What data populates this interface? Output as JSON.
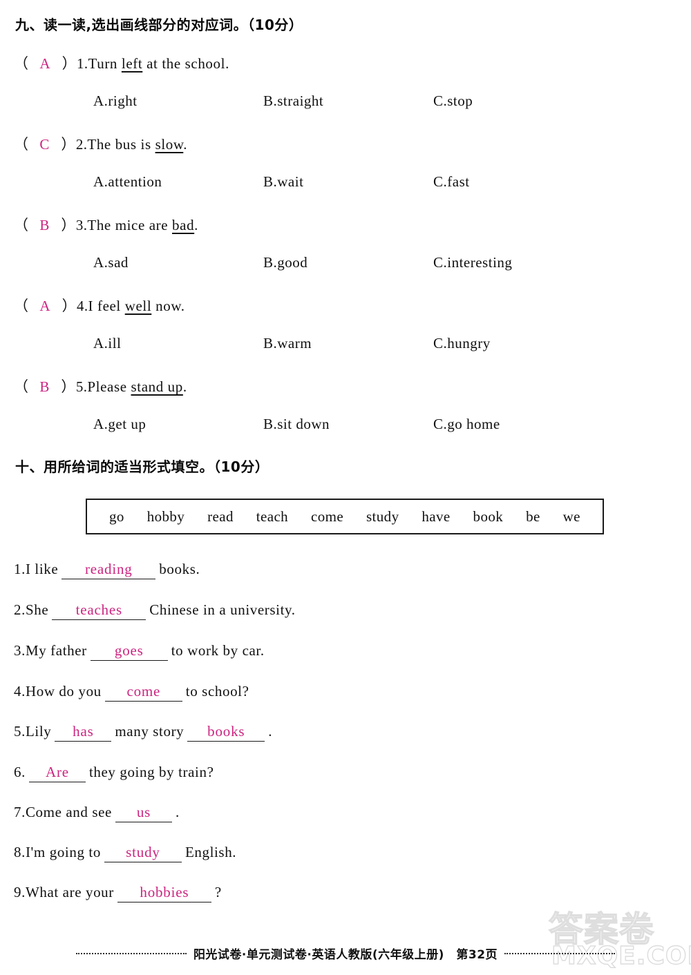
{
  "section9": {
    "heading": "九、读一读,选出画线部分的对应词。（10分）",
    "questions": [
      {
        "answer": "A",
        "number": "1.",
        "stem_before": "Turn ",
        "stem_underlined": "left",
        "stem_after": " at the school.",
        "options": {
          "a": "A.right",
          "b": "B.straight",
          "c": "C.stop"
        }
      },
      {
        "answer": "C",
        "number": "2.",
        "stem_before": "The bus is ",
        "stem_underlined": "slow",
        "stem_after": ".",
        "options": {
          "a": "A.attention",
          "b": "B.wait",
          "c": "C.fast"
        }
      },
      {
        "answer": "B",
        "number": "3.",
        "stem_before": "The mice are ",
        "stem_underlined": "bad",
        "stem_after": ".",
        "options": {
          "a": "A.sad",
          "b": "B.good",
          "c": "C.interesting"
        }
      },
      {
        "answer": "A",
        "number": "4.",
        "stem_before": "I feel ",
        "stem_underlined": "well",
        "stem_after": " now.",
        "options": {
          "a": "A.ill",
          "b": "B.warm",
          "c": "C.hungry"
        }
      },
      {
        "answer": "B",
        "number": "5.",
        "stem_before": "Please ",
        "stem_underlined": "stand up",
        "stem_after": ".",
        "options": {
          "a": "A.get up",
          "b": "B.sit down",
          "c": "C.go home"
        }
      }
    ]
  },
  "section10": {
    "heading": "十、用所给词的适当形式填空。（10分）",
    "word_bank": [
      "go",
      "hobby",
      "read",
      "teach",
      "come",
      "study",
      "have",
      "book",
      "be",
      "we"
    ],
    "items": [
      {
        "number": "1.",
        "before": "I like",
        "blank1": "reading",
        "middle": "books.",
        "blank2": null,
        "after": null
      },
      {
        "number": "2.",
        "before": "She",
        "blank1": "teaches",
        "middle": "Chinese in a university.",
        "blank2": null,
        "after": null
      },
      {
        "number": "3.",
        "before": "My father",
        "blank1": "goes",
        "middle": "to work by car.",
        "blank2": null,
        "after": null
      },
      {
        "number": "4.",
        "before": "How do you",
        "blank1": "come",
        "middle": "to school?",
        "blank2": null,
        "after": null
      },
      {
        "number": "5.",
        "before": "Lily",
        "blank1": "has",
        "middle": "many story",
        "blank2": "books",
        "after": "."
      },
      {
        "number": "6.",
        "before": "",
        "blank1": "Are",
        "middle": "they going by train?",
        "blank2": null,
        "after": null
      },
      {
        "number": "7.",
        "before": "Come and see",
        "blank1": "us",
        "middle": ".",
        "blank2": null,
        "after": null
      },
      {
        "number": "8.",
        "before": "I'm going to",
        "blank1": "study",
        "middle": "English.",
        "blank2": null,
        "after": null
      },
      {
        "number": "9.",
        "before": "What are your",
        "blank1": "hobbies",
        "middle": "?",
        "blank2": null,
        "after": null
      }
    ]
  },
  "footer": {
    "text": "阳光试卷·单元测试卷·英语人教版(六年级上册)　第32页"
  },
  "watermark": {
    "chinese": "答案卷",
    "english": "MXQE.COM"
  },
  "colors": {
    "answer_ink": "#cc2480",
    "body_ink": "#111111",
    "page_bg": "#ffffff"
  }
}
